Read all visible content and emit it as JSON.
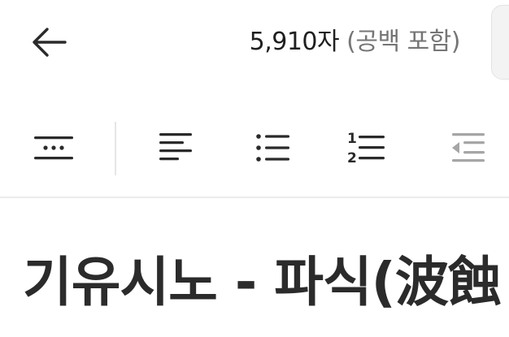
{
  "header": {
    "back_icon": "arrow-left-icon",
    "char_count": "5,910자",
    "char_count_note": "(공백 포함)"
  },
  "toolbar": {
    "tools": [
      {
        "icon": "page-break-icon"
      },
      {
        "icon": "align-left-icon"
      },
      {
        "icon": "bulleted-list-icon"
      },
      {
        "icon": "numbered-list-icon"
      },
      {
        "icon": "outdent-icon"
      }
    ]
  },
  "document": {
    "title": "기유시노 - 파식(波蝕"
  },
  "colors": {
    "text_primary": "#222222",
    "text_muted": "#757575",
    "icon": "#2a2a2a",
    "icon_disabled": "#a6a6a6",
    "divider": "#ececec"
  }
}
